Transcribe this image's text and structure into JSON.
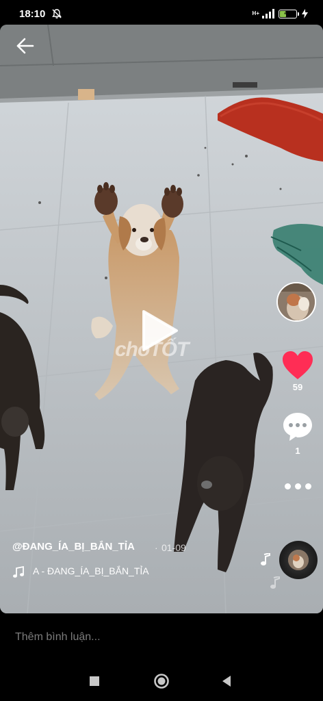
{
  "status_bar": {
    "time": "18:10",
    "network": "H+",
    "battery": "40",
    "battery_level": 0.4,
    "icons": [
      "mute-icon",
      "signal-icon",
      "battery-icon",
      "charging-icon"
    ]
  },
  "video": {
    "watermark": "choTỐT",
    "icons": [
      "back-arrow-icon",
      "play-icon"
    ]
  },
  "actions": {
    "likes": "59",
    "comments": "1",
    "accent_color": "#ff2d55",
    "icons": [
      "heart-icon",
      "comment-icon",
      "more-icon",
      "music-disc-icon"
    ]
  },
  "caption": {
    "author": "@ĐANG_ÍA_BỊ_BẮN_TỈA",
    "separator": "·",
    "date": "01-09",
    "music": "A - ĐANG_ÍA_BỊ_BẮN_TỈA"
  },
  "comment_box": {
    "placeholder": "Thêm bình luận..."
  },
  "nav": {
    "icons": [
      "recents-icon",
      "home-icon",
      "back-icon"
    ]
  }
}
